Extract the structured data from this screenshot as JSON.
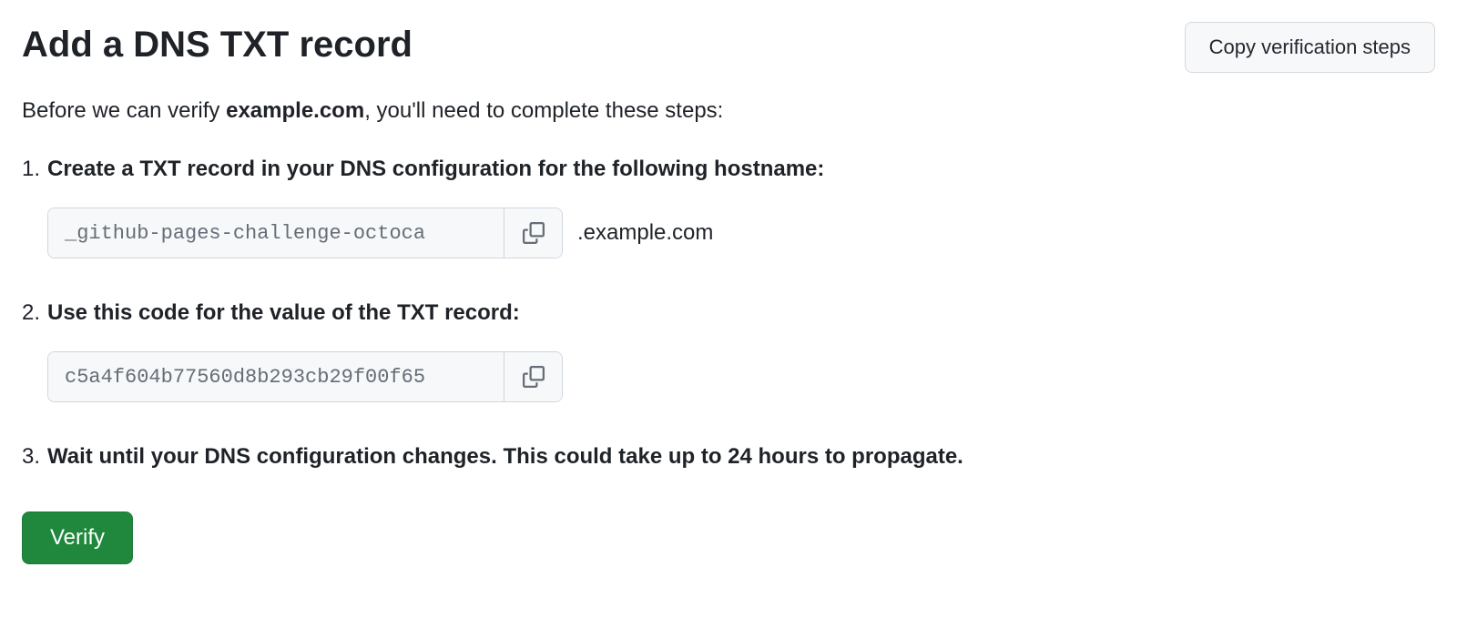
{
  "header": {
    "title": "Add a DNS TXT record",
    "copy_steps_label": "Copy verification steps"
  },
  "intro": {
    "prefix": "Before we can verify ",
    "domain": "example.com",
    "suffix": ", you'll need to complete these steps:"
  },
  "steps": {
    "step1": {
      "label": "Create a TXT record in your DNS configuration for the following hostname:",
      "hostname_value": "_github-pages-challenge-octoca",
      "domain_suffix": ".example.com"
    },
    "step2": {
      "label": "Use this code for the value of the TXT record:",
      "code_value": "c5a4f604b77560d8b293cb29f00f65"
    },
    "step3": {
      "label": "Wait until your DNS configuration changes. This could take up to 24 hours to propagate."
    }
  },
  "actions": {
    "verify_label": "Verify"
  }
}
